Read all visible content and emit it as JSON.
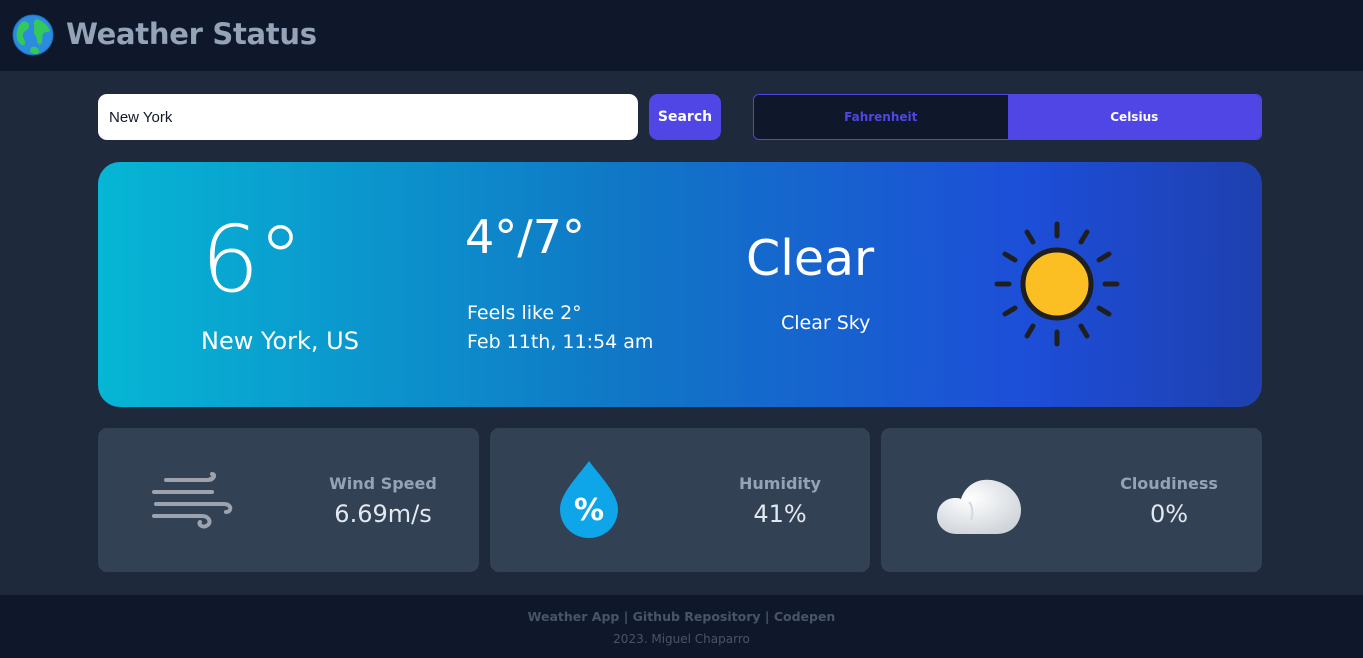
{
  "header": {
    "title": "Weather Status",
    "logo_icon": "earth-globe-icon"
  },
  "search": {
    "value": "New York",
    "button_label": "Search"
  },
  "units": {
    "options": [
      "Fahrenheit",
      "Celsius"
    ],
    "selected": "Celsius"
  },
  "current": {
    "temperature": "6°",
    "location": "New York, US",
    "temp_range": "4°/7°",
    "feels_like": "Feels like 2°",
    "datetime": "Feb 11th, 11:54 am",
    "condition": "Clear",
    "condition_desc": "Clear Sky",
    "condition_icon": "sun-icon"
  },
  "stats": [
    {
      "label": "Wind Speed",
      "value": "6.69m/s",
      "icon": "wind-icon"
    },
    {
      "label": "Humidity",
      "value": "41%",
      "icon": "humidity-drop-icon"
    },
    {
      "label": "Cloudiness",
      "value": "0%",
      "icon": "cloud-icon"
    }
  ],
  "footer": {
    "links": [
      "Weather App",
      "Github Repository",
      "Codepen"
    ],
    "separator": "|",
    "copyright": "2023. Miguel Chaparro"
  },
  "colors": {
    "background": "#1e293b",
    "header_bg": "#0f172a",
    "accent": "#4f46e5",
    "card_bg": "#334155",
    "sun_fill": "#fbbf24",
    "drop_fill": "#0ea5e9"
  }
}
